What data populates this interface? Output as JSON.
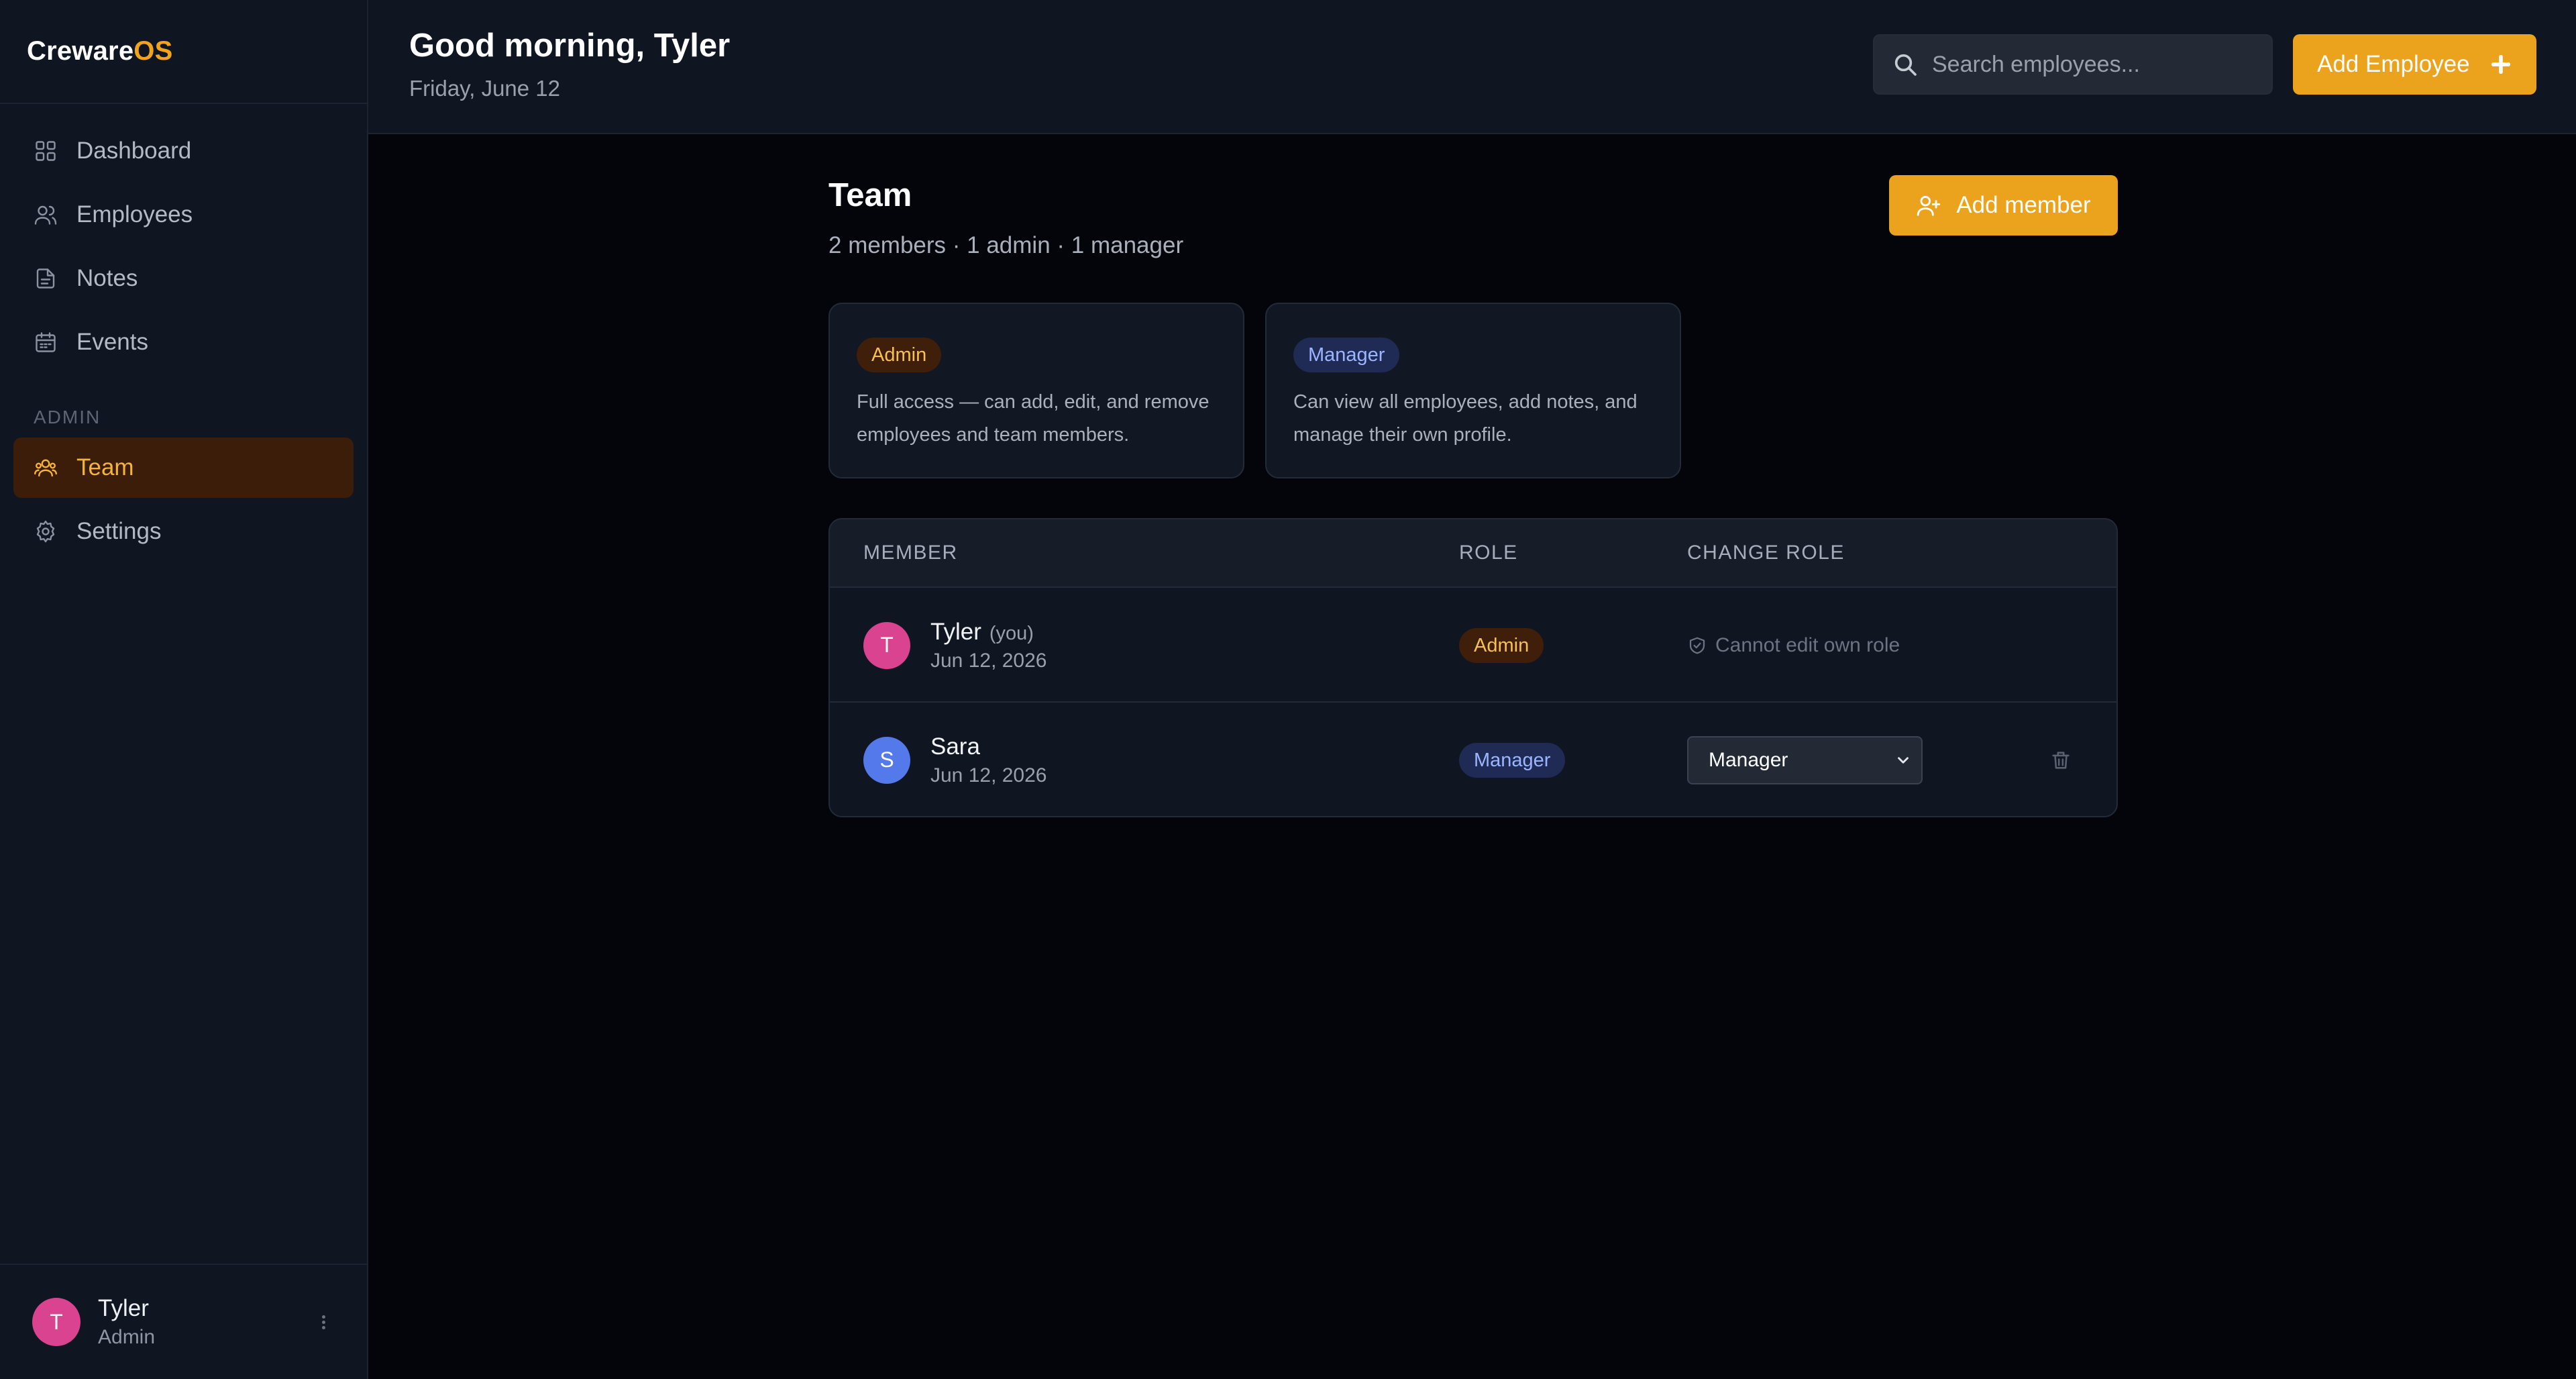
{
  "brand": {
    "part1": "Creware",
    "part2": "OS"
  },
  "sidebar": {
    "items": [
      {
        "label": "Dashboard",
        "icon": "grid-icon"
      },
      {
        "label": "Employees",
        "icon": "users-icon"
      },
      {
        "label": "Notes",
        "icon": "file-icon"
      },
      {
        "label": "Events",
        "icon": "calendar-icon"
      }
    ],
    "section_label": "ADMIN",
    "admin_items": [
      {
        "label": "Team",
        "icon": "team-icon",
        "active": true
      },
      {
        "label": "Settings",
        "icon": "gear-icon"
      }
    ],
    "user": {
      "initial": "T",
      "name": "Tyler",
      "role": "Admin"
    }
  },
  "header": {
    "greeting": "Good morning, Tyler",
    "date": "Friday, June 12",
    "search_placeholder": "Search employees...",
    "add_employee_label": "Add Employee"
  },
  "team": {
    "title": "Team",
    "subtitle": "2 members · 1 admin · 1 manager",
    "add_member_label": "Add member",
    "roles": [
      {
        "badge": "Admin",
        "description": "Full access — can add, edit, and remove employees and team members."
      },
      {
        "badge": "Manager",
        "description": "Can view all employees, add notes, and manage their own profile."
      }
    ],
    "table": {
      "headers": {
        "member": "MEMBER",
        "role": "ROLE",
        "change_role": "CHANGE ROLE"
      },
      "rows": [
        {
          "initial": "T",
          "name": "Tyler",
          "you": "(you)",
          "date": "Jun 12, 2026",
          "role": "Admin",
          "change_role_text": "Cannot edit own role"
        },
        {
          "initial": "S",
          "name": "Sara",
          "date": "Jun 12, 2026",
          "role": "Manager",
          "selected_role": "Manager"
        }
      ]
    }
  },
  "colors": {
    "accent": "#eba31e",
    "sidebar_bg": "#0f1521",
    "page_bg": "#03050b",
    "admin_badge_bg": "#3f1e0a",
    "manager_badge_bg": "#1f2a55",
    "avatar_pink": "#d9438f",
    "avatar_blue": "#5479ea"
  }
}
